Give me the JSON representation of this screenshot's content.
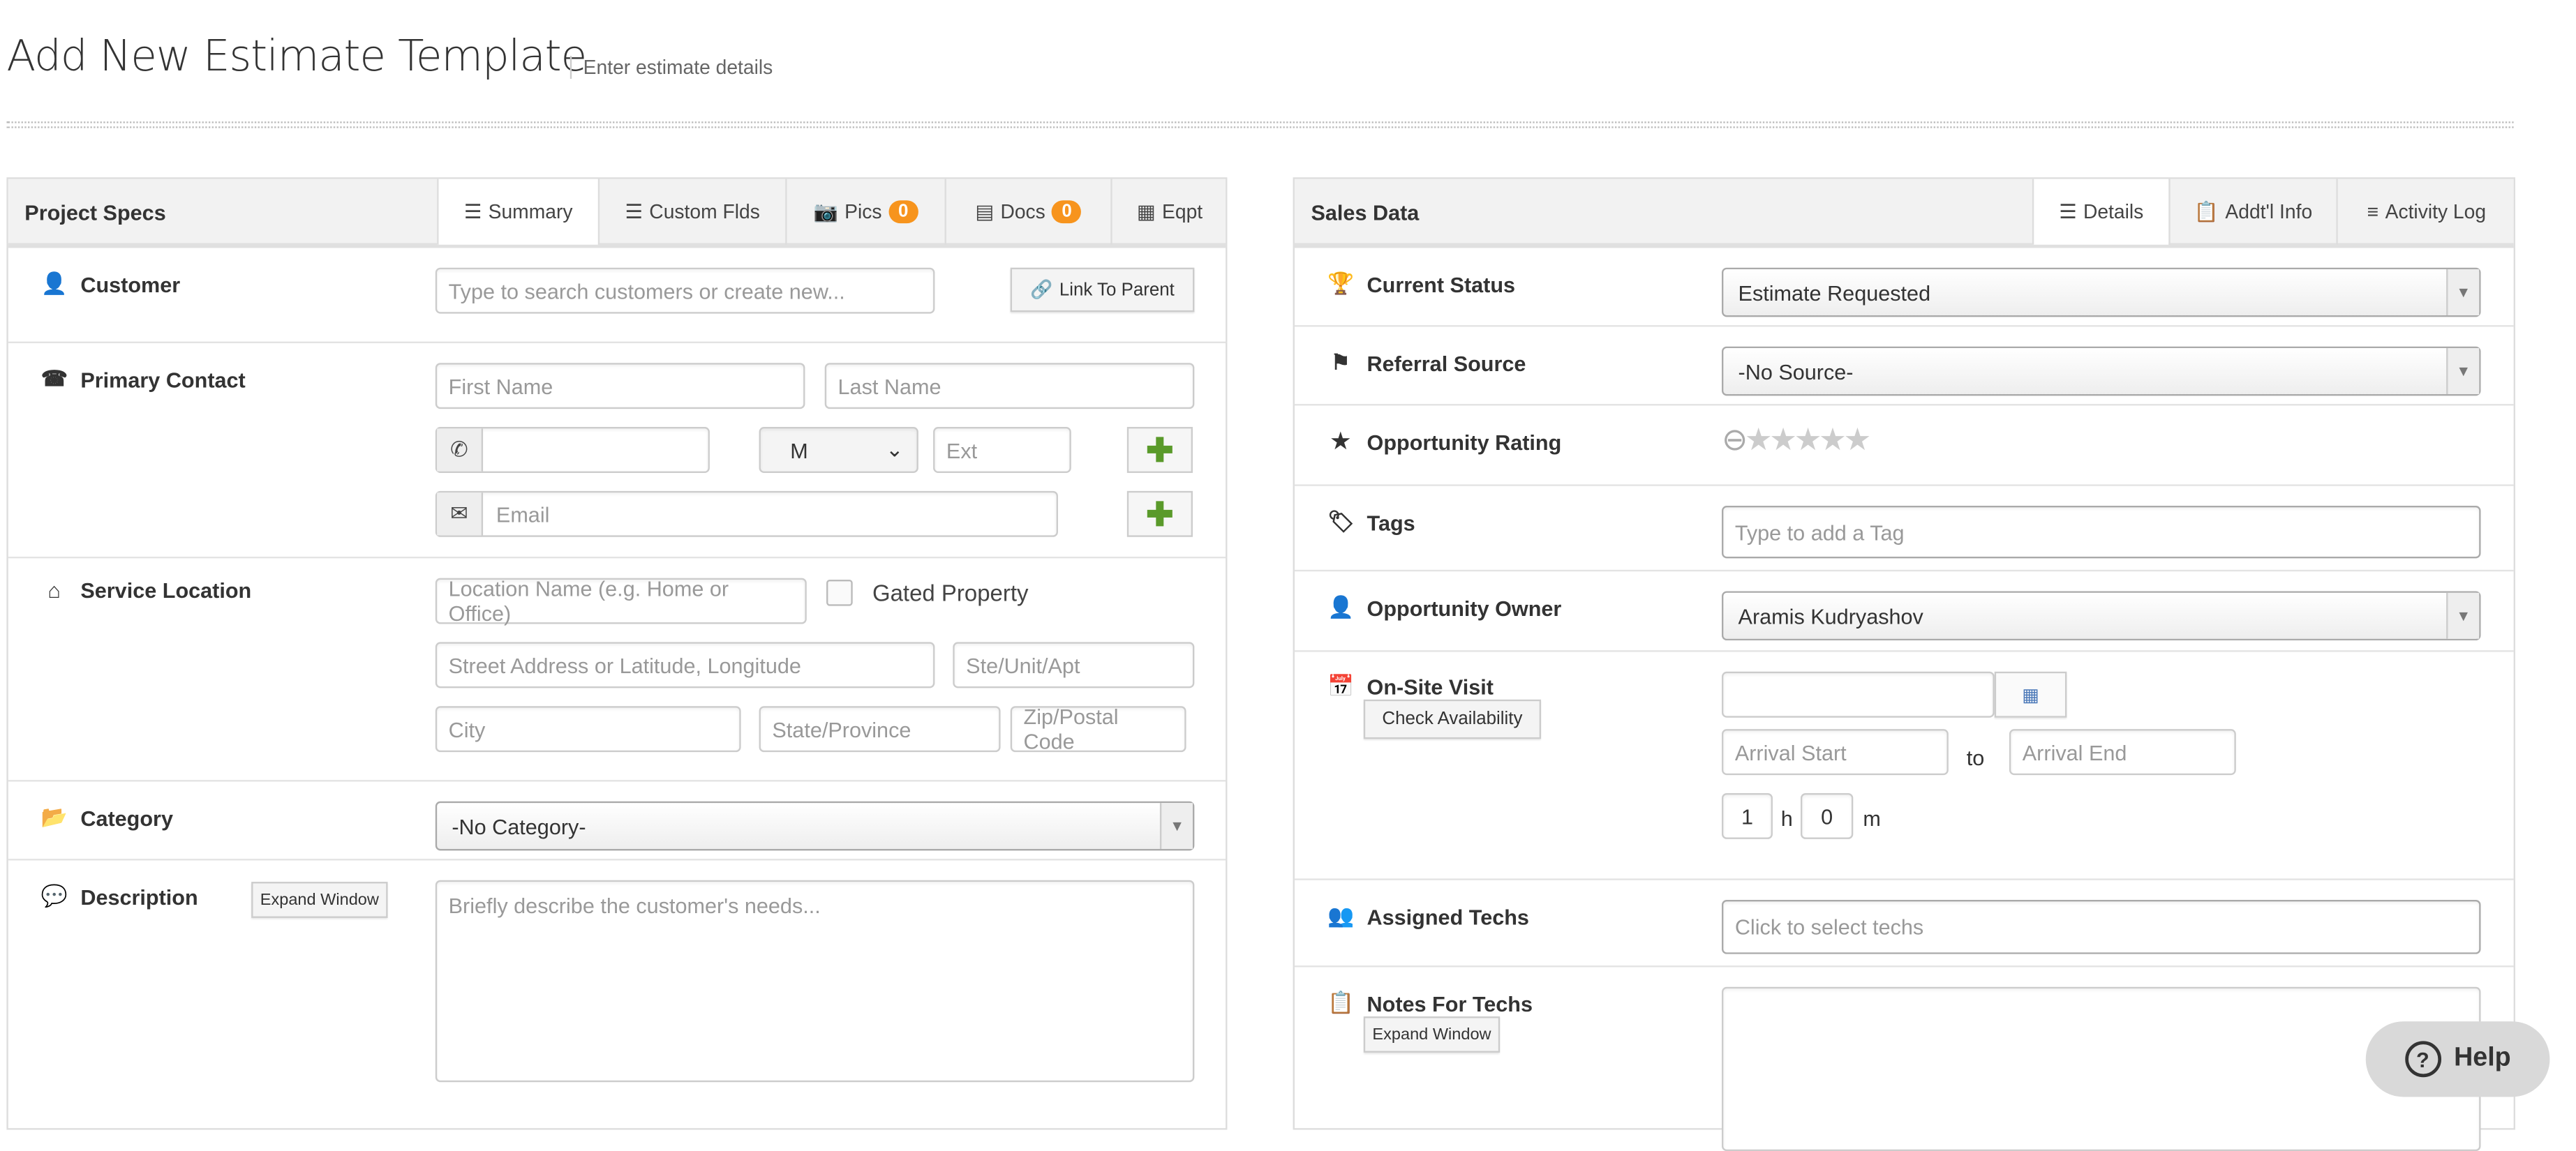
{
  "page": {
    "title": "Add New Estimate Template",
    "subtitle": "Enter estimate details"
  },
  "project": {
    "title": "Project Specs",
    "tabs": [
      {
        "label": "Summary",
        "icon": "list-icon"
      },
      {
        "label": "Custom Flds",
        "icon": "list-icon"
      },
      {
        "label": "Pics",
        "icon": "camera-icon",
        "count": "0"
      },
      {
        "label": "Docs",
        "icon": "document-icon",
        "count": "0"
      },
      {
        "label": "Eqpt",
        "icon": "equipment-icon"
      }
    ],
    "customer": {
      "label": "Customer",
      "placeholder": "Type to search customers or create new...",
      "link_parent": "Link To Parent"
    },
    "contact": {
      "label": "Primary Contact",
      "first": "First Name",
      "last": "Last Name",
      "phone_type": "M",
      "ext": "Ext",
      "email": "Email"
    },
    "location": {
      "label": "Service Location",
      "name": "Location Name (e.g. Home or Office)",
      "gated": "Gated Property",
      "street": "Street Address or Latitude, Longitude",
      "unit": "Ste/Unit/Apt",
      "city": "City",
      "state": "State/Province",
      "zip": "Zip/Postal Code"
    },
    "category": {
      "label": "Category",
      "value": "-No Category-"
    },
    "description": {
      "label": "Description",
      "expand": "Expand Window",
      "placeholder": "Briefly describe the customer's needs..."
    }
  },
  "sales": {
    "title": "Sales Data",
    "tabs": [
      {
        "label": "Details",
        "icon": "list-icon"
      },
      {
        "label": "Addt'l Info",
        "icon": "clipboard-icon"
      },
      {
        "label": "Activity Log",
        "icon": "lines-icon"
      }
    ],
    "status": {
      "label": "Current Status",
      "value": "Estimate Requested"
    },
    "referral": {
      "label": "Referral Source",
      "value": "-No Source-"
    },
    "rating": {
      "label": "Opportunity Rating",
      "value": 0,
      "max": 5
    },
    "tags": {
      "label": "Tags",
      "placeholder": "Type to add a Tag"
    },
    "owner": {
      "label": "Opportunity Owner",
      "value": "Aramis Kudryashov"
    },
    "visit": {
      "label": "On-Site Visit",
      "check": "Check Availability",
      "arrival_start": "Arrival Start",
      "to": "to",
      "arrival_end": "Arrival End",
      "hours": "1",
      "h": "h",
      "minutes": "0",
      "m": "m"
    },
    "techs": {
      "label": "Assigned Techs",
      "placeholder": "Click to select techs"
    },
    "notes": {
      "label": "Notes For Techs",
      "expand": "Expand Window"
    }
  },
  "help": {
    "label": "Help"
  },
  "colors": {
    "badge": "#f7941d",
    "plus": "#5a9a2a",
    "header": "#f2f2f2"
  }
}
